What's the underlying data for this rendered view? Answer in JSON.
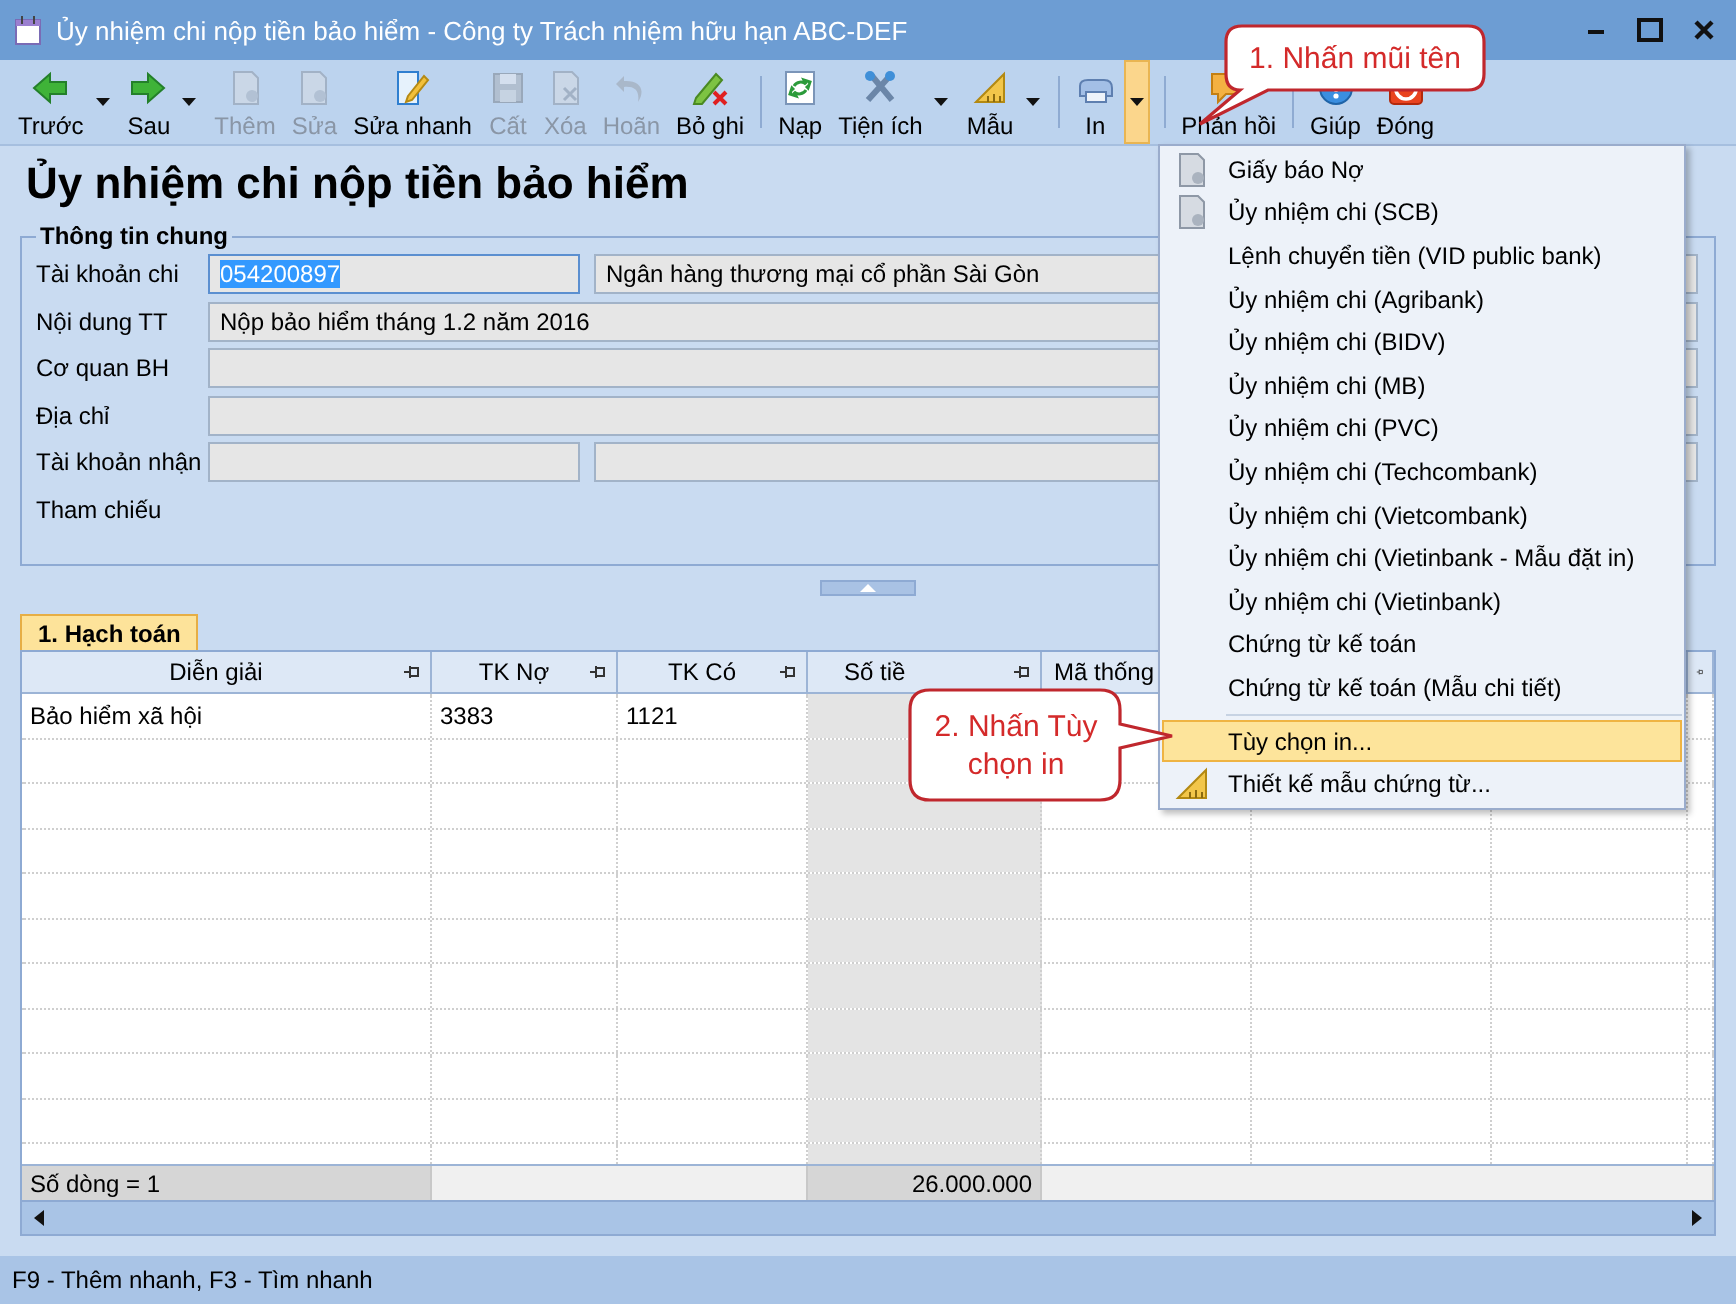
{
  "window": {
    "title": "Ủy nhiệm chi nộp tiền bảo hiểm - Công ty Trách nhiệm hữu hạn ABC-DEF"
  },
  "toolbar": [
    {
      "kind": "button",
      "label": "Trước",
      "disabled": false,
      "dropdown": true,
      "pressed": false
    },
    {
      "kind": "button",
      "label": "Sau",
      "disabled": false,
      "dropdown": true,
      "pressed": false
    },
    {
      "kind": "button",
      "label": "Thêm",
      "disabled": true,
      "dropdown": false,
      "pressed": false
    },
    {
      "kind": "button",
      "label": "Sửa",
      "disabled": true,
      "dropdown": false,
      "pressed": false
    },
    {
      "kind": "button",
      "label": "Sửa nhanh",
      "disabled": false,
      "dropdown": false,
      "pressed": false
    },
    {
      "kind": "button",
      "label": "Cất",
      "disabled": true,
      "dropdown": false,
      "pressed": false
    },
    {
      "kind": "button",
      "label": "Xóa",
      "disabled": true,
      "dropdown": false,
      "pressed": false
    },
    {
      "kind": "button",
      "label": "Hoãn",
      "disabled": true,
      "dropdown": false,
      "pressed": false
    },
    {
      "kind": "button",
      "label": "Bỏ ghi",
      "disabled": false,
      "dropdown": false,
      "pressed": false
    },
    {
      "kind": "separator"
    },
    {
      "kind": "button",
      "label": "Nạp",
      "disabled": false,
      "dropdown": false,
      "pressed": false
    },
    {
      "kind": "button",
      "label": "Tiện ích",
      "disabled": false,
      "dropdown": true,
      "pressed": false
    },
    {
      "kind": "button",
      "label": "Mẫu",
      "disabled": false,
      "dropdown": true,
      "pressed": false
    },
    {
      "kind": "separator"
    },
    {
      "kind": "button",
      "label": "In",
      "disabled": false,
      "dropdown": true,
      "pressed": true
    },
    {
      "kind": "separator"
    },
    {
      "kind": "button",
      "label": "Phản hồi",
      "disabled": false,
      "dropdown": false,
      "pressed": false
    },
    {
      "kind": "separator"
    },
    {
      "kind": "button",
      "label": "Giúp",
      "disabled": false,
      "dropdown": false,
      "pressed": false
    },
    {
      "kind": "button",
      "label": "Đóng",
      "disabled": false,
      "dropdown": false,
      "pressed": false
    }
  ],
  "heading": "Ủy nhiệm chi nộp tiền bảo hiểm",
  "general": {
    "legend": "Thông tin chung",
    "rows": [
      {
        "label": "Tài khoản chi",
        "fields": [
          {
            "value": "054200897",
            "selected": true
          },
          {
            "value": "Ngân hàng thương mại cổ phần Sài Gòn",
            "selected": false
          }
        ]
      },
      {
        "label": "Nội dung TT",
        "fields": [
          {
            "value": "Nộp bảo hiểm tháng 1.2 năm 2016",
            "selected": false
          }
        ]
      },
      {
        "label": "Cơ quan BH",
        "fields": [
          {
            "selected": false
          }
        ]
      },
      {
        "label": "Địa chỉ",
        "fields": [
          {
            "selected": false
          }
        ]
      },
      {
        "label": "Tài khoản nhận",
        "fields": [
          {
            "selected": false
          },
          {
            "selected": false
          }
        ]
      },
      {
        "label": "Tham chiếu"
      }
    ]
  },
  "tabs": [
    {
      "label": "1. Hạch toán",
      "selected": true
    }
  ],
  "grid": {
    "columns": [
      "Diễn giải",
      "TK Nợ",
      "TK Có",
      "Số tiề",
      "Mã thống"
    ],
    "rows": [
      {
        "cells": [
          "Bảo hiểm xã hội",
          "3383",
          "1121"
        ]
      }
    ],
    "footer": {
      "count": "Số dòng = 1",
      "total": "26.000.000"
    }
  },
  "print_menu": {
    "groups": [
      [
        {
          "label": "Giấy báo Nợ",
          "selected": false
        },
        {
          "label": "Ủy nhiệm chi (SCB)",
          "selected": false
        },
        {
          "label": "Lệnh chuyển tiền (VID public bank)",
          "selected": false
        },
        {
          "label": "Ủy nhiệm chi (Agribank)",
          "selected": false
        },
        {
          "label": "Ủy nhiệm chi (BIDV)",
          "selected": false
        },
        {
          "label": "Ủy nhiệm chi (MB)",
          "selected": false
        },
        {
          "label": "Ủy nhiệm chi (PVC)",
          "selected": false
        },
        {
          "label": "Ủy nhiệm chi (Techcombank)",
          "selected": false
        },
        {
          "label": "Ủy nhiệm chi (Vietcombank)",
          "selected": false
        },
        {
          "label": "Ủy nhiệm chi (Vietinbank - Mẫu đặt in)",
          "selected": false
        },
        {
          "label": "Ủy nhiệm chi (Vietinbank)",
          "selected": false
        },
        {
          "label": "Chứng từ kế toán",
          "selected": false
        },
        {
          "label": "Chứng từ kế toán (Mẫu chi tiết)",
          "selected": false
        }
      ],
      [
        {
          "label": "Tùy chọn in...",
          "selected": true
        },
        {
          "label": "Thiết kế mẫu chứng từ...",
          "selected": false
        }
      ]
    ]
  },
  "callouts": [
    "1. Nhấn mũi tên",
    "2. Nhấn Tùy chọn in"
  ],
  "status_bar": "F9 - Thêm nhanh, F3 - Tìm nhanh"
}
